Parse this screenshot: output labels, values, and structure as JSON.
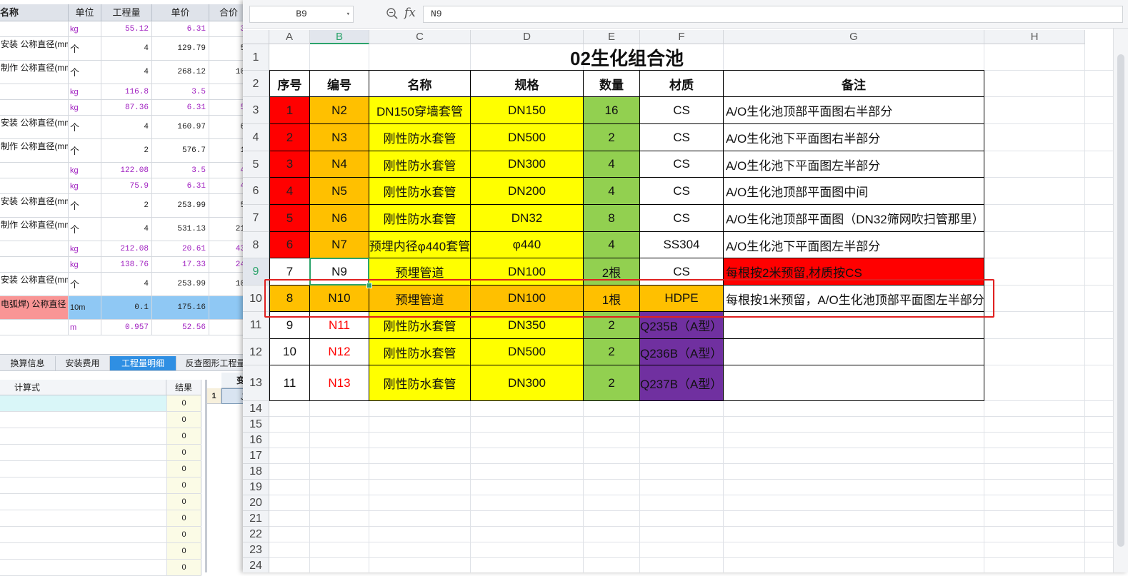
{
  "background_app": {
    "headers": [
      "名称",
      "单位",
      "工程量",
      "单价",
      "合价"
    ],
    "rows": [
      {
        "name": "",
        "unit": "kg",
        "qty": "55.12",
        "price": "6.31",
        "total": "3",
        "kind": "sub"
      },
      {
        "name": "安装 公称直径(mm",
        "unit": "个",
        "qty": "4",
        "price": "129.79",
        "total": "5",
        "kind": "main"
      },
      {
        "name": "制作 公称直径(mm",
        "unit": "个",
        "qty": "4",
        "price": "268.12",
        "total": "10",
        "kind": "main"
      },
      {
        "name": "",
        "unit": "kg",
        "qty": "116.8",
        "price": "3.5",
        "total": "",
        "kind": "sub"
      },
      {
        "name": "",
        "unit": "kg",
        "qty": "87.36",
        "price": "6.31",
        "total": "5",
        "kind": "sub"
      },
      {
        "name": "安装 公称直径(mm",
        "unit": "个",
        "qty": "4",
        "price": "160.97",
        "total": "6",
        "kind": "main"
      },
      {
        "name": "制作 公称直径(mm",
        "unit": "个",
        "qty": "2",
        "price": "576.7",
        "total": "1",
        "kind": "main"
      },
      {
        "name": "",
        "unit": "kg",
        "qty": "122.08",
        "price": "3.5",
        "total": "4",
        "kind": "sub"
      },
      {
        "name": "",
        "unit": "kg",
        "qty": "75.9",
        "price": "6.31",
        "total": "4",
        "kind": "sub"
      },
      {
        "name": "安装 公称直径(mm",
        "unit": "个",
        "qty": "2",
        "price": "253.99",
        "total": "5",
        "kind": "main"
      },
      {
        "name": "制作 公称直径(mm",
        "unit": "个",
        "qty": "4",
        "price": "531.13",
        "total": "21",
        "kind": "main"
      },
      {
        "name": "",
        "unit": "kg",
        "qty": "212.08",
        "price": "20.61",
        "total": "43",
        "kind": "sub"
      },
      {
        "name": "",
        "unit": "kg",
        "qty": "138.76",
        "price": "17.33",
        "total": "24",
        "kind": "sub"
      },
      {
        "name": "安装 公称直径(mm",
        "unit": "个",
        "qty": "4",
        "price": "253.99",
        "total": "10",
        "kind": "main"
      },
      {
        "name": "电弧焊) 公称直径",
        "unit": "10m",
        "qty": "0.1",
        "price": "175.16",
        "total": "",
        "kind": "selected"
      },
      {
        "name": "",
        "unit": "m",
        "qty": "0.957",
        "price": "52.56",
        "total": "",
        "kind": "sub"
      }
    ],
    "tabs": [
      "换算信息",
      "安装费用",
      "工程量明细",
      "反查图形工程量"
    ],
    "active_tab": 2,
    "lower_headers": {
      "formula": "计算式",
      "result": "结果",
      "right_partial": "变"
    },
    "lower_results": [
      "0",
      "0",
      "0",
      "0",
      "0",
      "0",
      "0",
      "0",
      "0",
      "0",
      "0"
    ],
    "side_row": {
      "index": "1",
      "value": "J"
    }
  },
  "spreadsheet": {
    "namebox": "B9",
    "formula": "N9",
    "columns": [
      "A",
      "B",
      "C",
      "D",
      "E",
      "F",
      "G",
      "H"
    ],
    "selected_column": "B",
    "selected_row": "9",
    "title": "02生化组合池",
    "header_row": [
      "序号",
      "编号",
      "名称",
      "规格",
      "数量",
      "材质",
      "备注"
    ],
    "rows": [
      {
        "r": "3",
        "cells": [
          "1",
          "N2",
          "DN150穿墙套管",
          "DN150",
          "16",
          "CS",
          "A/O生化池顶部平面图右半部分"
        ]
      },
      {
        "r": "4",
        "cells": [
          "2",
          "N3",
          "刚性防水套管",
          "DN500",
          "2",
          "CS",
          "A/O生化池下平面图右半部分"
        ]
      },
      {
        "r": "5",
        "cells": [
          "3",
          "N4",
          "刚性防水套管",
          "DN300",
          "4",
          "CS",
          "A/O生化池下平面图左半部分"
        ]
      },
      {
        "r": "6",
        "cells": [
          "4",
          "N5",
          "刚性防水套管",
          "DN200",
          "4",
          "CS",
          "A/O生化池顶部平面图中间"
        ]
      },
      {
        "r": "7",
        "cells": [
          "5",
          "N6",
          "刚性防水套管",
          "DN32",
          "8",
          "CS",
          "A/O生化池顶部平面图（DN32筛网吹扫管那里）"
        ]
      },
      {
        "r": "8",
        "cells": [
          "6",
          "N7",
          "预埋内径φ440套管",
          "φ440",
          "4",
          "SS304",
          "A/O生化池下平面图左半部分"
        ]
      },
      {
        "r": "9",
        "cells": [
          "7",
          "N9",
          "预埋管道",
          "DN100",
          "2根",
          "CS",
          "每根按2米预留,材质按CS"
        ]
      },
      {
        "r": "10",
        "cells": [
          "8",
          "N10",
          "预埋管道",
          "DN100",
          "1根",
          "HDPE",
          "每根按1米预留，A/O生化池顶部平面图左半部分"
        ]
      },
      {
        "r": "11",
        "cells": [
          "9",
          "N11",
          "刚性防水套管",
          "DN350",
          "2",
          "Q235B（A型）",
          ""
        ]
      },
      {
        "r": "12",
        "cells": [
          "10",
          "N12",
          "刚性防水套管",
          "DN500",
          "2",
          "Q236B（A型）",
          ""
        ]
      },
      {
        "r": "13",
        "cells": [
          "11",
          "N13",
          "刚性防水套管",
          "DN300",
          "2",
          "Q237B（A型）",
          ""
        ]
      }
    ],
    "empty_rows": [
      "14",
      "15",
      "16",
      "17",
      "18",
      "19",
      "20",
      "21",
      "22",
      "23",
      "24"
    ],
    "colors": {
      "red": "#ff0000",
      "orange": "#ffc000",
      "yellow": "#ffff00",
      "green": "#92d050",
      "purple": "#7030a0",
      "red_text": "#ff0000",
      "highlight_box": "#e02020",
      "selection": "#2ba36b"
    }
  }
}
